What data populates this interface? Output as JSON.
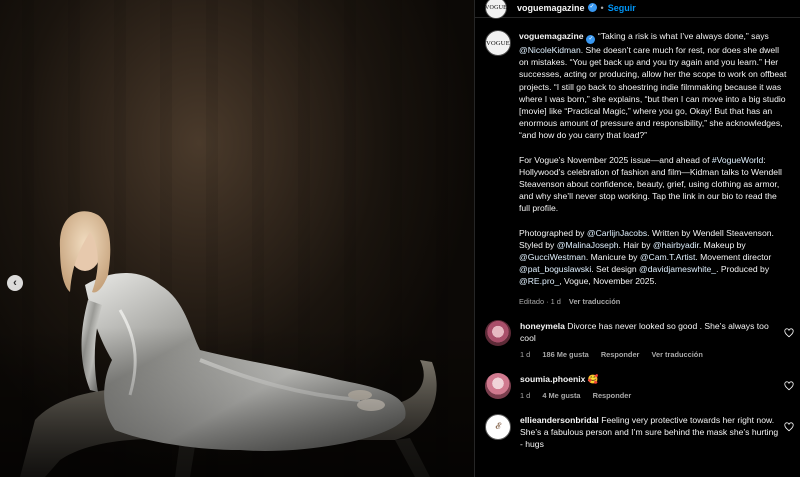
{
  "post_header": {
    "avatar_text": "VOGUE",
    "username": "voguemagazine",
    "separator": "•",
    "follow_label": "Seguir"
  },
  "carousel": {
    "prev_icon": "‹"
  },
  "caption": {
    "username": "voguemagazine",
    "p1": " “Taking a risk is what I’ve always done,” says ",
    "mention_kidman": "@NicoleKidman",
    "p1b": ". She doesn’t care much for rest, nor does she dwell on mistakes. “You get back up and you try again and you learn.” Her successes, acting or producing, allow her the scope to work on offbeat projects. “I still go back to shoestring indie filmmaking because it was where I was born,” she explains, “but then I can move into a big studio [movie] like “Practical Magic,” where you go, Okay! But that has an enormous amount of pressure and responsibility,” she acknowledges, “and how do you carry that load?”",
    "p2a": "For Vogue’s November 2025 issue—and ahead of ",
    "hashtag": "#VogueWorld",
    "p2b": ": Hollywood’s celebration of fashion and film—Kidman talks to Wendell Steavenson about confidence, beauty, grief, using clothing as armor, and why she’ll never stop working. Tap the link in our bio to read the full profile.",
    "p3_t1": "Photographed by ",
    "m_jacobs": "@CarlijnJacobs",
    "p3_t2": ". Written by Wendell Steavenson. Styled by ",
    "m_joseph": "@MalinaJoseph",
    "p3_t3": ". Hair by ",
    "m_hair": "@hairbyadir",
    "p3_t4": ". Makeup by ",
    "m_westman": "@GucciWestman",
    "p3_t5": ". Manicure by ",
    "m_cam": "@Cam.T.Artist",
    "p3_t6": ". Movement director ",
    "m_pat": "@pat_boguslawski",
    "p3_t7": ". Set design ",
    "m_david": "@davidjameswhite_",
    "p3_t8": ". Produced by ",
    "m_re": "@RE.pro_",
    "p3_t9": ", Vogue, November 2025.",
    "meta_time": "Editado · 1 d",
    "meta_translate": "Ver traducción"
  },
  "comments": [
    {
      "username": "honeymela",
      "text": " Divorce has never looked so good . She’s always too cool",
      "time": "1 d",
      "likes": "186 Me gusta",
      "reply": "Responder",
      "translate": "Ver traducción"
    },
    {
      "username": "soumia.phoenix",
      "text": " 🥰",
      "time": "1 d",
      "likes": "4 Me gusta",
      "reply": "Responder"
    },
    {
      "username": "ellieandersonbridal",
      "text": " Feeling very protective towards her right now. She’s a fabulous person and I’m sure behind the mask she’s hurting - hugs"
    }
  ],
  "colors": {
    "link": "#e0f1ff",
    "follow": "#0095f6",
    "verified": "#3897f0",
    "muted": "#a8a8a8"
  }
}
